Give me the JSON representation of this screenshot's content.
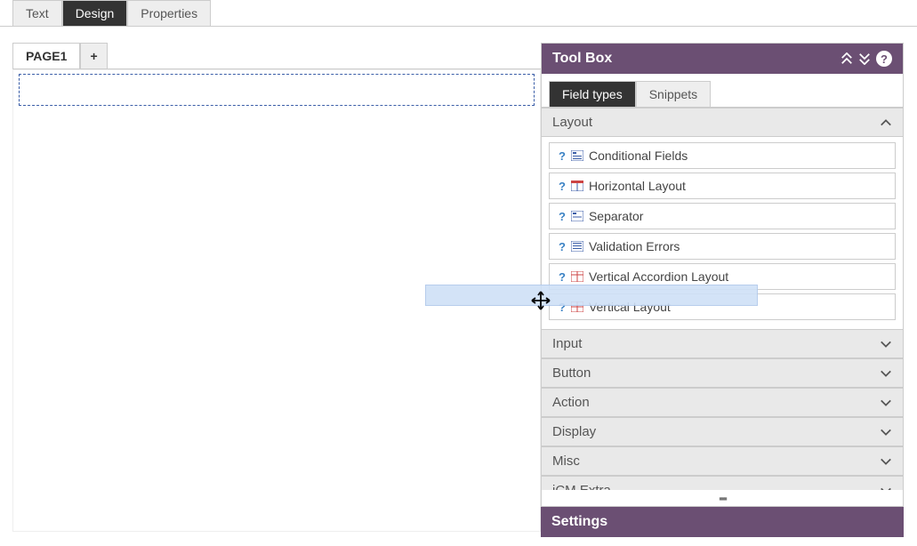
{
  "topTabs": {
    "text": "Text",
    "design": "Design",
    "properties": "Properties"
  },
  "pageTabs": {
    "page1": "PAGE1",
    "add": "+"
  },
  "toolbox": {
    "title": "Tool Box",
    "tabs": {
      "fieldTypes": "Field types",
      "snippets": "Snippets"
    },
    "categories": {
      "layout": {
        "label": "Layout",
        "items": [
          {
            "label": "Conditional Fields",
            "icon": "cond"
          },
          {
            "label": "Horizontal Layout",
            "icon": "horiz"
          },
          {
            "label": "Separator",
            "icon": "sep"
          },
          {
            "label": "Validation Errors",
            "icon": "valid"
          },
          {
            "label": "Vertical Accordion Layout",
            "icon": "vacc"
          },
          {
            "label": "Vertical Layout",
            "icon": "vert"
          }
        ]
      },
      "input": {
        "label": "Input"
      },
      "button": {
        "label": "Button"
      },
      "action": {
        "label": "Action"
      },
      "display": {
        "label": "Display"
      },
      "misc": {
        "label": "Misc"
      },
      "icmExtra": {
        "label": "iCM Extra"
      }
    }
  },
  "settings": {
    "title": "Settings"
  },
  "helpGlyph": "?"
}
